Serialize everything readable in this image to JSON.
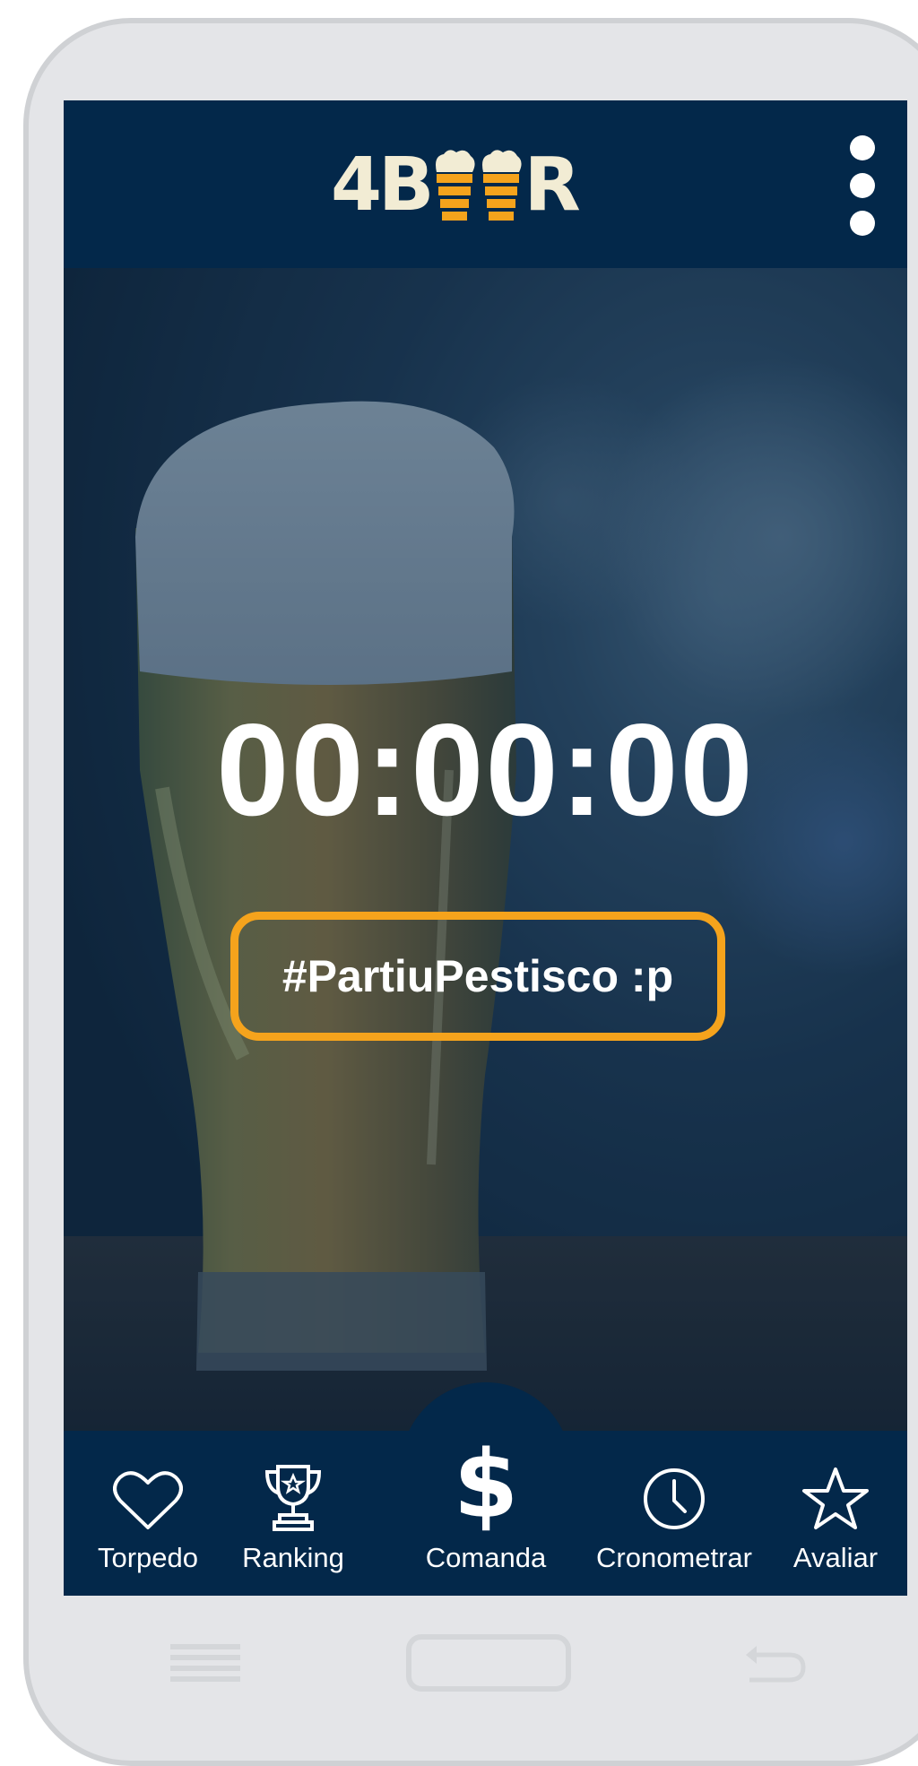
{
  "app": {
    "logo_text_left": "4B",
    "logo_text_right": "R",
    "overflow_menu_icon": "more-vertical-icon"
  },
  "timer": {
    "value": "00:00:00"
  },
  "hashtag": {
    "label": "#PartiuPestisco :p"
  },
  "bottom_nav": {
    "items": [
      {
        "label": "Torpedo",
        "icon": "heart-icon"
      },
      {
        "label": "Ranking",
        "icon": "trophy-icon"
      },
      {
        "label": "Comanda",
        "icon": "dollar-icon",
        "glyph": "$"
      },
      {
        "label": "Cronometrar",
        "icon": "clock-icon"
      },
      {
        "label": "Avaliar",
        "icon": "star-icon"
      }
    ]
  },
  "system_nav": {
    "items": [
      "menu-icon",
      "home-button",
      "back-icon"
    ]
  },
  "colors": {
    "primary": "#03284a",
    "accent": "#f5a31c",
    "logo_cream": "#f2ecd4",
    "text": "#ffffff"
  }
}
